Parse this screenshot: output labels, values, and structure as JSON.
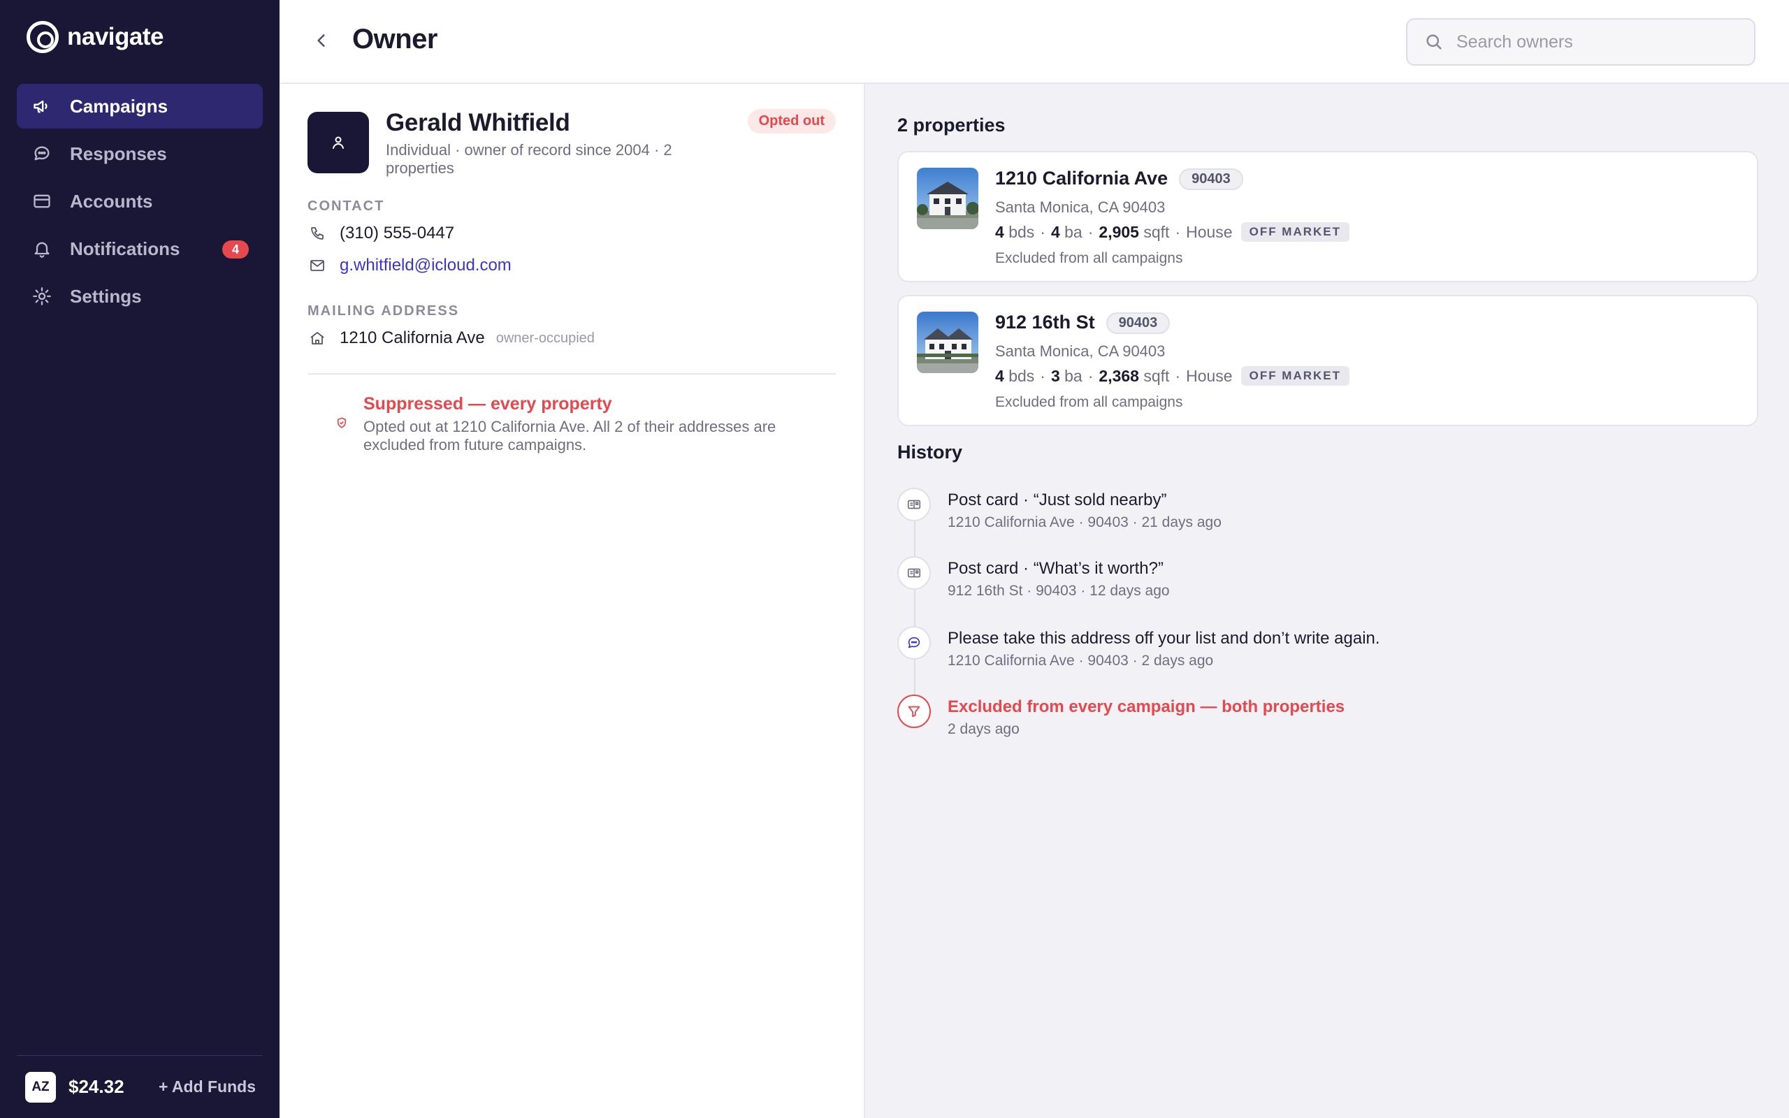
{
  "brand": {
    "name": "navigate"
  },
  "nav": {
    "items": [
      {
        "label": "Campaigns",
        "icon": "megaphone-icon",
        "active": true
      },
      {
        "label": "Responses",
        "icon": "chat-bubble-icon"
      },
      {
        "label": "Accounts",
        "icon": "card-icon"
      },
      {
        "label": "Notifications",
        "icon": "bell-icon",
        "badge": "4"
      },
      {
        "label": "Settings",
        "icon": "gear-icon"
      }
    ]
  },
  "account": {
    "initials": "AZ",
    "balance": "$24.32",
    "add_funds": "Add Funds"
  },
  "header": {
    "title": "Owner",
    "search_placeholder": "Search owners"
  },
  "owner": {
    "name": "Gerald Whitfield",
    "subtitle": "Individual · owner of record since 2004 · 2 properties",
    "status": "Opted out",
    "contact_label": "CONTACT",
    "phone": "(310) 555-0447",
    "email": "g.whitfield@icloud.com",
    "mailing_label": "MAILING ADDRESS",
    "mailing_address": "1210 California Ave",
    "mailing_tag": "owner-occupied"
  },
  "suppression": {
    "title": "Suppressed — every property",
    "text": "Opted out at 1210 California Ave. All 2 of their addresses are excluded from future campaigns."
  },
  "properties": {
    "title": "2 properties",
    "items": [
      {
        "address": "1210 California Ave",
        "zip": "90403",
        "city": "Santa Monica, CA 90403",
        "beds": "4",
        "beds_unit": "bds",
        "baths": "4",
        "baths_unit": "ba",
        "sqft": "2,905",
        "sqft_unit": "sqft",
        "type": "House",
        "market": "OFF MARKET",
        "note": "Excluded from all campaigns"
      },
      {
        "address": "912 16th St",
        "zip": "90403",
        "city": "Santa Monica, CA 90403",
        "beds": "4",
        "beds_unit": "bds",
        "baths": "3",
        "baths_unit": "ba",
        "sqft": "2,368",
        "sqft_unit": "sqft",
        "type": "House",
        "market": "OFF MARKET",
        "note": "Excluded from all campaigns"
      }
    ]
  },
  "history": {
    "title": "History",
    "items": [
      {
        "title": "Post card · “Just sold nearby”",
        "meta": "1210 California Ave · 90403 · 21 days ago",
        "icon": "postcard-icon"
      },
      {
        "title": "Post card · “What’s it worth?”",
        "meta": "912 16th St · 90403 · 12 days ago",
        "icon": "postcard-icon"
      },
      {
        "title": "Please take this address off your list and don’t write again.",
        "meta": "1210 California Ave · 90403 · 2 days ago",
        "icon": "chat-bubble-icon"
      },
      {
        "title": "Excluded from every campaign — both properties",
        "meta": "2 days ago",
        "icon": "filter-icon"
      }
    ]
  },
  "colors": {
    "sidebar": "#1a1636",
    "active_nav": "#2e2870",
    "danger": "#e5484d",
    "link": "#3b35c9"
  }
}
